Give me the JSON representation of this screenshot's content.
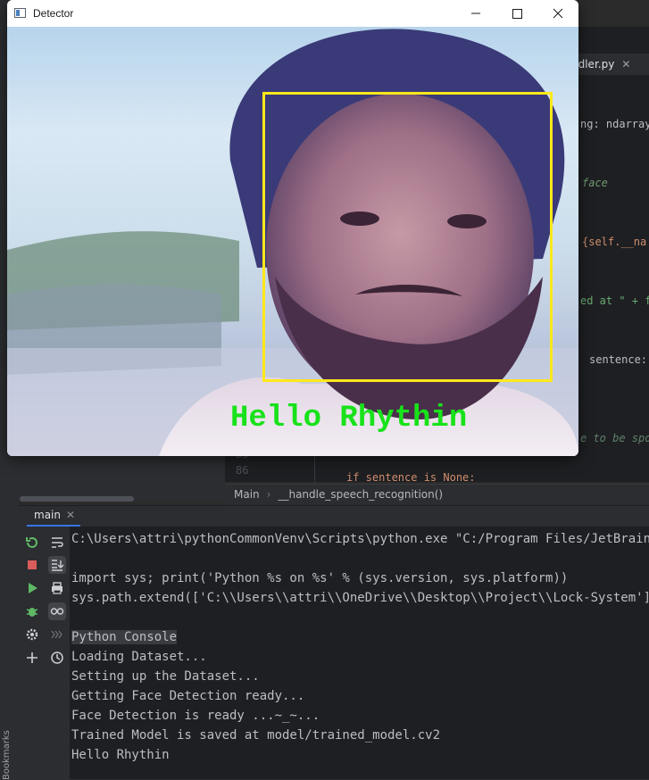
{
  "ide": {
    "editor_tab_label": "ndler.py",
    "code_fragments": [
      {
        "text": "ng: ndarray",
        "color": "#bcbec4"
      },
      {
        "text": "face",
        "color": "#6f9b6f"
      },
      {
        "text": "{self.__na",
        "color": "#cf8e6d"
      },
      {
        "text": "ed at \" + f",
        "color": "#6aab73"
      },
      {
        "text": "sentence:",
        "color": "#bcbec4"
      },
      {
        "text": "e to be spo",
        "color": "#5f826b"
      },
      {
        "text": "if sentence is None:",
        "color": "#cf8e6d"
      }
    ],
    "gutter_line_numbers": [
      "85",
      "86"
    ],
    "breadcrumb": [
      "Main",
      "__handle_speech_recognition()"
    ],
    "bookmarks_label": "Bookmarks"
  },
  "run_panel": {
    "tab_label": "main",
    "console_lines": [
      "C:\\Users\\attri\\pythonCommonVenv\\Scripts\\python.exe \"C:/Program Files/JetBrains/Py",
      "",
      "import sys; print('Python %s on %s' % (sys.version, sys.platform))",
      "sys.path.extend(['C:\\\\Users\\\\attri\\\\OneDrive\\\\Desktop\\\\Project\\\\Lock-System'])",
      "",
      "Python Console",
      "Loading Dataset...",
      "Setting up the Dataset...",
      "Getting Face Detection ready...",
      "Face Detection is ready ...~_~...",
      "Trained Model is saved at model/trained_model.cv2",
      "Hello Rhythin"
    ]
  },
  "detector_window": {
    "title": "Detector",
    "overlay_label": "Hello Rhythin",
    "colors": {
      "label": "#18e21a",
      "face_box": "#ffe81a"
    }
  },
  "colors": {
    "ide_background": "#1e1f22",
    "panel_background": "#2b2d30",
    "console_text": "#bcbec4",
    "accent": "#3574f0"
  }
}
